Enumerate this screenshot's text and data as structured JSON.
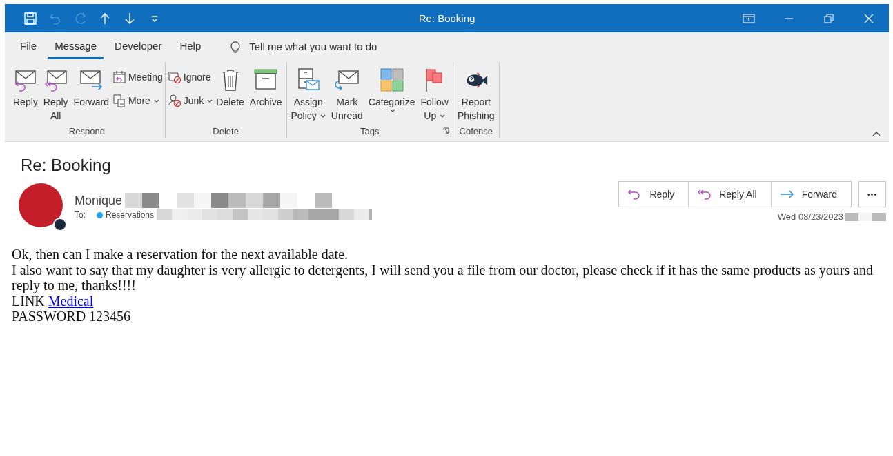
{
  "window": {
    "title": "Re: Booking"
  },
  "quick_access": [
    {
      "disabled": false
    },
    {
      "disabled": true
    },
    {
      "disabled": true
    },
    {
      "disabled": false
    },
    {
      "disabled": false
    },
    {
      "disabled": false
    }
  ],
  "menu_tabs": [
    {
      "label": "File",
      "selected": false
    },
    {
      "label": "Message",
      "selected": true
    },
    {
      "label": "Developer",
      "selected": false
    },
    {
      "label": "Help",
      "selected": false
    }
  ],
  "tell_me": {
    "placeholder": "Tell me what you want to do"
  },
  "ribbon_groups": [
    {
      "label": "Respond",
      "launcher": false,
      "items": [
        {
          "kind": "large",
          "lines": [
            "Reply"
          ],
          "dropdown": false
        },
        {
          "kind": "large",
          "lines": [
            "Reply",
            "All"
          ],
          "dropdown": false
        },
        {
          "kind": "large",
          "lines": [
            "Forward"
          ],
          "dropdown": false
        },
        {
          "kind": "stack",
          "buttons": [
            {
              "label": "Meeting",
              "dropdown": false
            },
            {
              "label": "More",
              "dropdown": true
            }
          ]
        }
      ]
    },
    {
      "label": "Delete",
      "launcher": false,
      "items": [
        {
          "kind": "stack",
          "buttons": [
            {
              "label": "Ignore",
              "dropdown": false
            },
            {
              "label": "Junk",
              "dropdown": true
            }
          ]
        },
        {
          "kind": "large",
          "lines": [
            "Delete"
          ],
          "dropdown": false
        },
        {
          "kind": "large",
          "lines": [
            "Archive"
          ],
          "dropdown": false
        }
      ]
    },
    {
      "label": "Tags",
      "launcher": true,
      "items": [
        {
          "kind": "large",
          "lines": [
            "Assign",
            "Policy"
          ],
          "dropdown": true
        },
        {
          "kind": "large",
          "lines": [
            "Mark",
            "Unread"
          ],
          "dropdown": false
        },
        {
          "kind": "large",
          "lines": [
            "Categorize"
          ],
          "dropdown": true
        },
        {
          "kind": "large",
          "lines": [
            "Follow",
            "Up"
          ],
          "dropdown": true
        }
      ]
    },
    {
      "label": "Cofense",
      "launcher": false,
      "items": [
        {
          "kind": "large",
          "lines": [
            "Report",
            "Phishing"
          ],
          "dropdown": false
        }
      ]
    }
  ],
  "message": {
    "subject": "Re: Booking",
    "sender": "Monique",
    "to_label": "To:",
    "recipient": "Reservations",
    "actions": [
      {
        "label": "Reply"
      },
      {
        "label": "Reply All"
      },
      {
        "label": "Forward"
      }
    ],
    "more_label": "•••",
    "date": "Wed 08/23/2023",
    "body": [
      {
        "kind": "text",
        "text": "Ok, then can I make a reservation for the next available date."
      },
      {
        "kind": "text",
        "text": "I also want to say that my daughter is very allergic to detergents, I will send you a file from our doctor, please check if it has the same products as yours and reply to me, thanks!!!!"
      },
      {
        "kind": "link",
        "text": "LINK",
        "link": "Medical"
      },
      {
        "kind": "text",
        "text": "PASSWORD 123456"
      }
    ]
  }
}
